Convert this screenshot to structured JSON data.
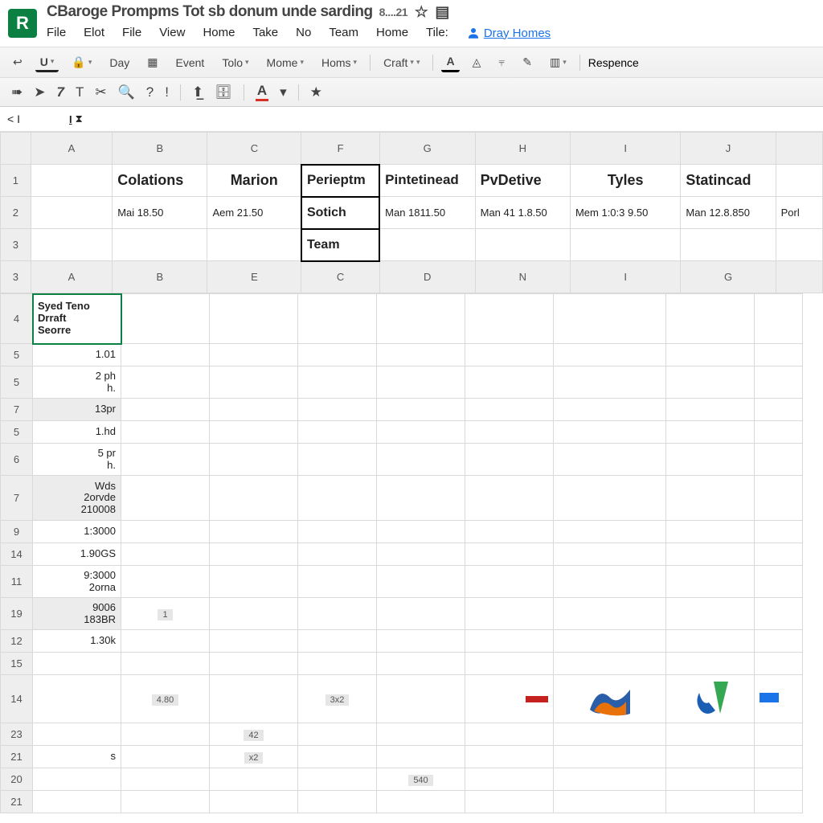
{
  "app": {
    "logo_letter": "R"
  },
  "document": {
    "title": "CBaroge Prompms Tot sb donum unde sarding",
    "title_suffix": "8....21"
  },
  "menu": [
    "File",
    "Elot",
    "File",
    "View",
    "Home",
    "Take",
    "No",
    "Team",
    "Home",
    "Tile:"
  ],
  "profile": {
    "label": "Dray Homes"
  },
  "toolbar1": {
    "items": {
      "day": "Day",
      "event": "Event",
      "tolo": "Tolo",
      "mome": "Mome",
      "homs": "Homs",
      "craft": "Craft",
      "response": "Respence"
    }
  },
  "namebox": {
    "value": "< I"
  },
  "sheet_top": {
    "cols": [
      "A",
      "B",
      "C",
      "F",
      "G",
      "H",
      "I",
      "J",
      ""
    ],
    "rows": [
      {
        "num": "1",
        "cells": [
          "",
          "Colations",
          "Marion",
          "Perieptm",
          "Pintetinead",
          "PvDetive",
          "Tyles",
          "Statincad",
          ""
        ]
      },
      {
        "num": "2",
        "cells": [
          "",
          "Mai 18.50",
          "Aem 21.50",
          "Sotich",
          "Man 1811.50",
          "Man 41 1.8.50",
          "Mem 1:0:3 9.50",
          "Man 12.8.850",
          "Porl"
        ]
      },
      {
        "num": "3",
        "cells": [
          "",
          "",
          "",
          "Team",
          "",
          "",
          "",
          "",
          ""
        ]
      }
    ]
  },
  "sheet_bottom": {
    "cols": [
      "A",
      "B",
      "E",
      "C",
      "D",
      "N",
      "I",
      "G",
      ""
    ],
    "row4": {
      "num": "4",
      "a": "Syed Teno\nDrraft\nSeorre"
    },
    "rows": [
      {
        "num": "5",
        "a": "1.01",
        "fill": false
      },
      {
        "num": "5",
        "a": "2 ph",
        "sub": "h."
      },
      {
        "num": "7",
        "a": "13pr",
        "fill": true
      },
      {
        "num": "5",
        "a": "1.hd"
      },
      {
        "num": "6",
        "a": "5 pr",
        "sub": "h."
      },
      {
        "num": "7",
        "a": "Wds",
        "a2": "2orvde",
        "a3": "210008",
        "fill": true
      },
      {
        "num": "9",
        "a": "1:3000"
      },
      {
        "num": "14",
        "a": "1.90GS"
      },
      {
        "num": "11",
        "a": "9:3000",
        "a2": "2orna"
      },
      {
        "num": "19",
        "a": "9006",
        "a2": "183BR",
        "fill": true,
        "b_chip": "1"
      },
      {
        "num": "12",
        "a": "1.30k",
        "fill": false
      },
      {
        "num": "15",
        "a": ""
      },
      {
        "num": "14",
        "a": "",
        "b_chip": "4.80",
        "c_chip": "3x2",
        "strip": true,
        "logos": true
      },
      {
        "num": "23",
        "a": "",
        "e_chip": "42"
      },
      {
        "num": "21",
        "a": "s",
        "e_chip": "x2"
      },
      {
        "num": "20",
        "a": "",
        "d_chip": "540"
      },
      {
        "num": "21",
        "a": ""
      }
    ]
  },
  "chart_data": {
    "type": "table",
    "title": "",
    "header_row": [
      "Colations",
      "Marion",
      "Perieptm",
      "Pintetinead",
      "PvDetive",
      "Tyles",
      "Statincad"
    ],
    "data_row": [
      "Mai 18.50",
      "Aem 21.50",
      "Sotich",
      "Man 1811.50",
      "Man 41 1.8.50",
      "Mem 1:0:3 9.50",
      "Man 12.8.850"
    ]
  }
}
